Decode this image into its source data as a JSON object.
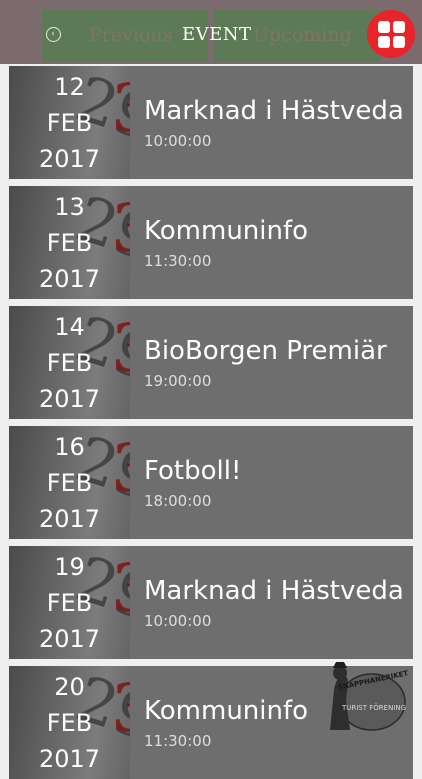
{
  "header": {
    "title": "EVENT",
    "prev_label": "Previous",
    "next_label": "Upcoming",
    "back_icon": "chevron-left-icon",
    "menu_icon": "grid-icon",
    "menu_color": "#e8232a"
  },
  "events": [
    {
      "day": "12",
      "month": "FEB",
      "year": "2017",
      "name": "Marknad i Hästveda",
      "time": "10:00:00"
    },
    {
      "day": "13",
      "month": "FEB",
      "year": "2017",
      "name": "Kommuninfo",
      "time": "11:30:00"
    },
    {
      "day": "14",
      "month": "FEB",
      "year": "2017",
      "name": "BioBorgen Premiär",
      "time": "19:00:00"
    },
    {
      "day": "16",
      "month": "FEB",
      "year": "2017",
      "name": "Fotboll!",
      "time": "18:00:00"
    },
    {
      "day": "19",
      "month": "FEB",
      "year": "2017",
      "name": "Marknad i Hästveda",
      "time": "10:00:00"
    },
    {
      "day": "20",
      "month": "FEB",
      "year": "2017",
      "name": "Kommuninfo",
      "time": "11:30:00"
    }
  ],
  "logo": {
    "text_top": "SNAPPHANERIKETS",
    "text_bottom": "TURIST FÖRENING"
  }
}
